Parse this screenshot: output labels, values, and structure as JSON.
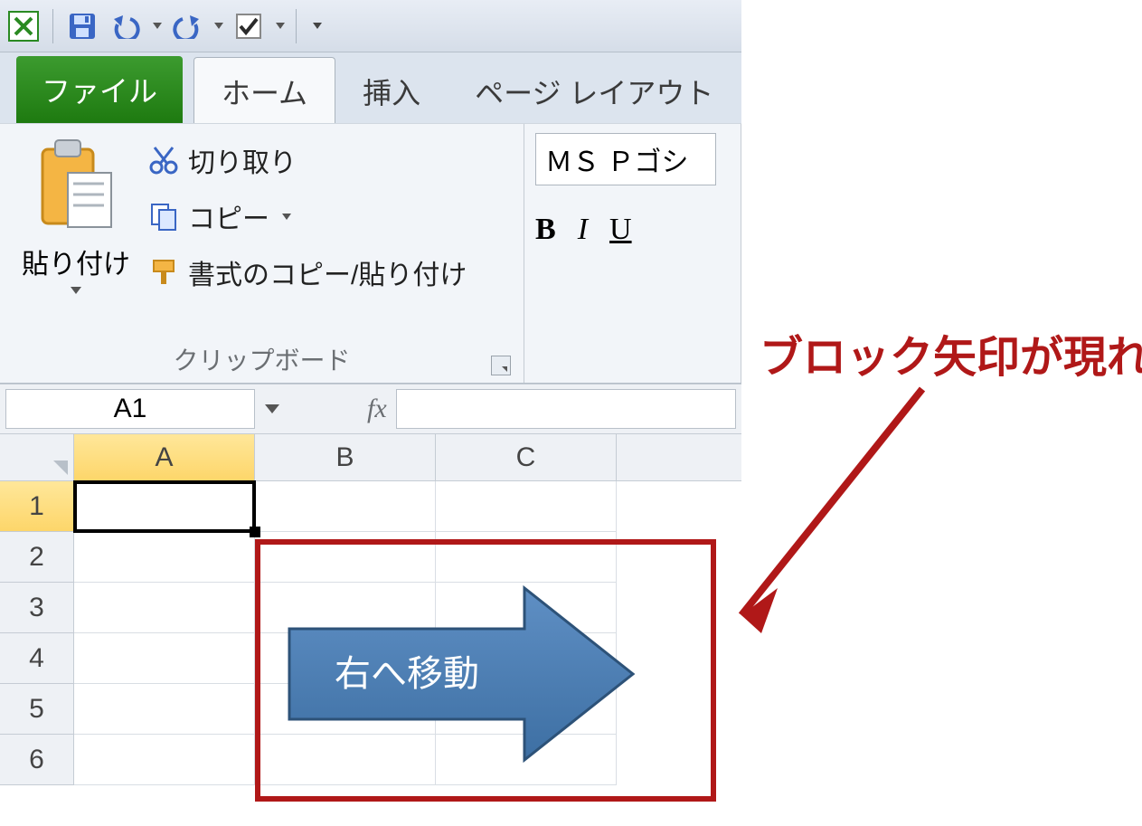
{
  "qat": {
    "icons": [
      "excel-app-icon",
      "save-icon",
      "undo-icon",
      "redo-icon",
      "checkbox-icon"
    ]
  },
  "tabs": {
    "file": "ファイル",
    "home": "ホーム",
    "insert": "挿入",
    "pageLayout": "ページ レイアウト"
  },
  "ribbon": {
    "paste": "貼り付け",
    "cut": "切り取り",
    "copy": "コピー",
    "formatPainter": "書式のコピー/貼り付け",
    "clipboardGroup": "クリップボード",
    "fontName": "ＭＳ Ｐゴシ",
    "bold": "B",
    "italic": "I",
    "underline": "U"
  },
  "formulaBar": {
    "nameBox": "A1",
    "fx": "fx"
  },
  "grid": {
    "cols": [
      "A",
      "B",
      "C"
    ],
    "rows": [
      "1",
      "2",
      "3",
      "4",
      "5",
      "6"
    ]
  },
  "annotation": {
    "label": "ブロック矢印が現れる",
    "arrowText": "右へ移動"
  }
}
